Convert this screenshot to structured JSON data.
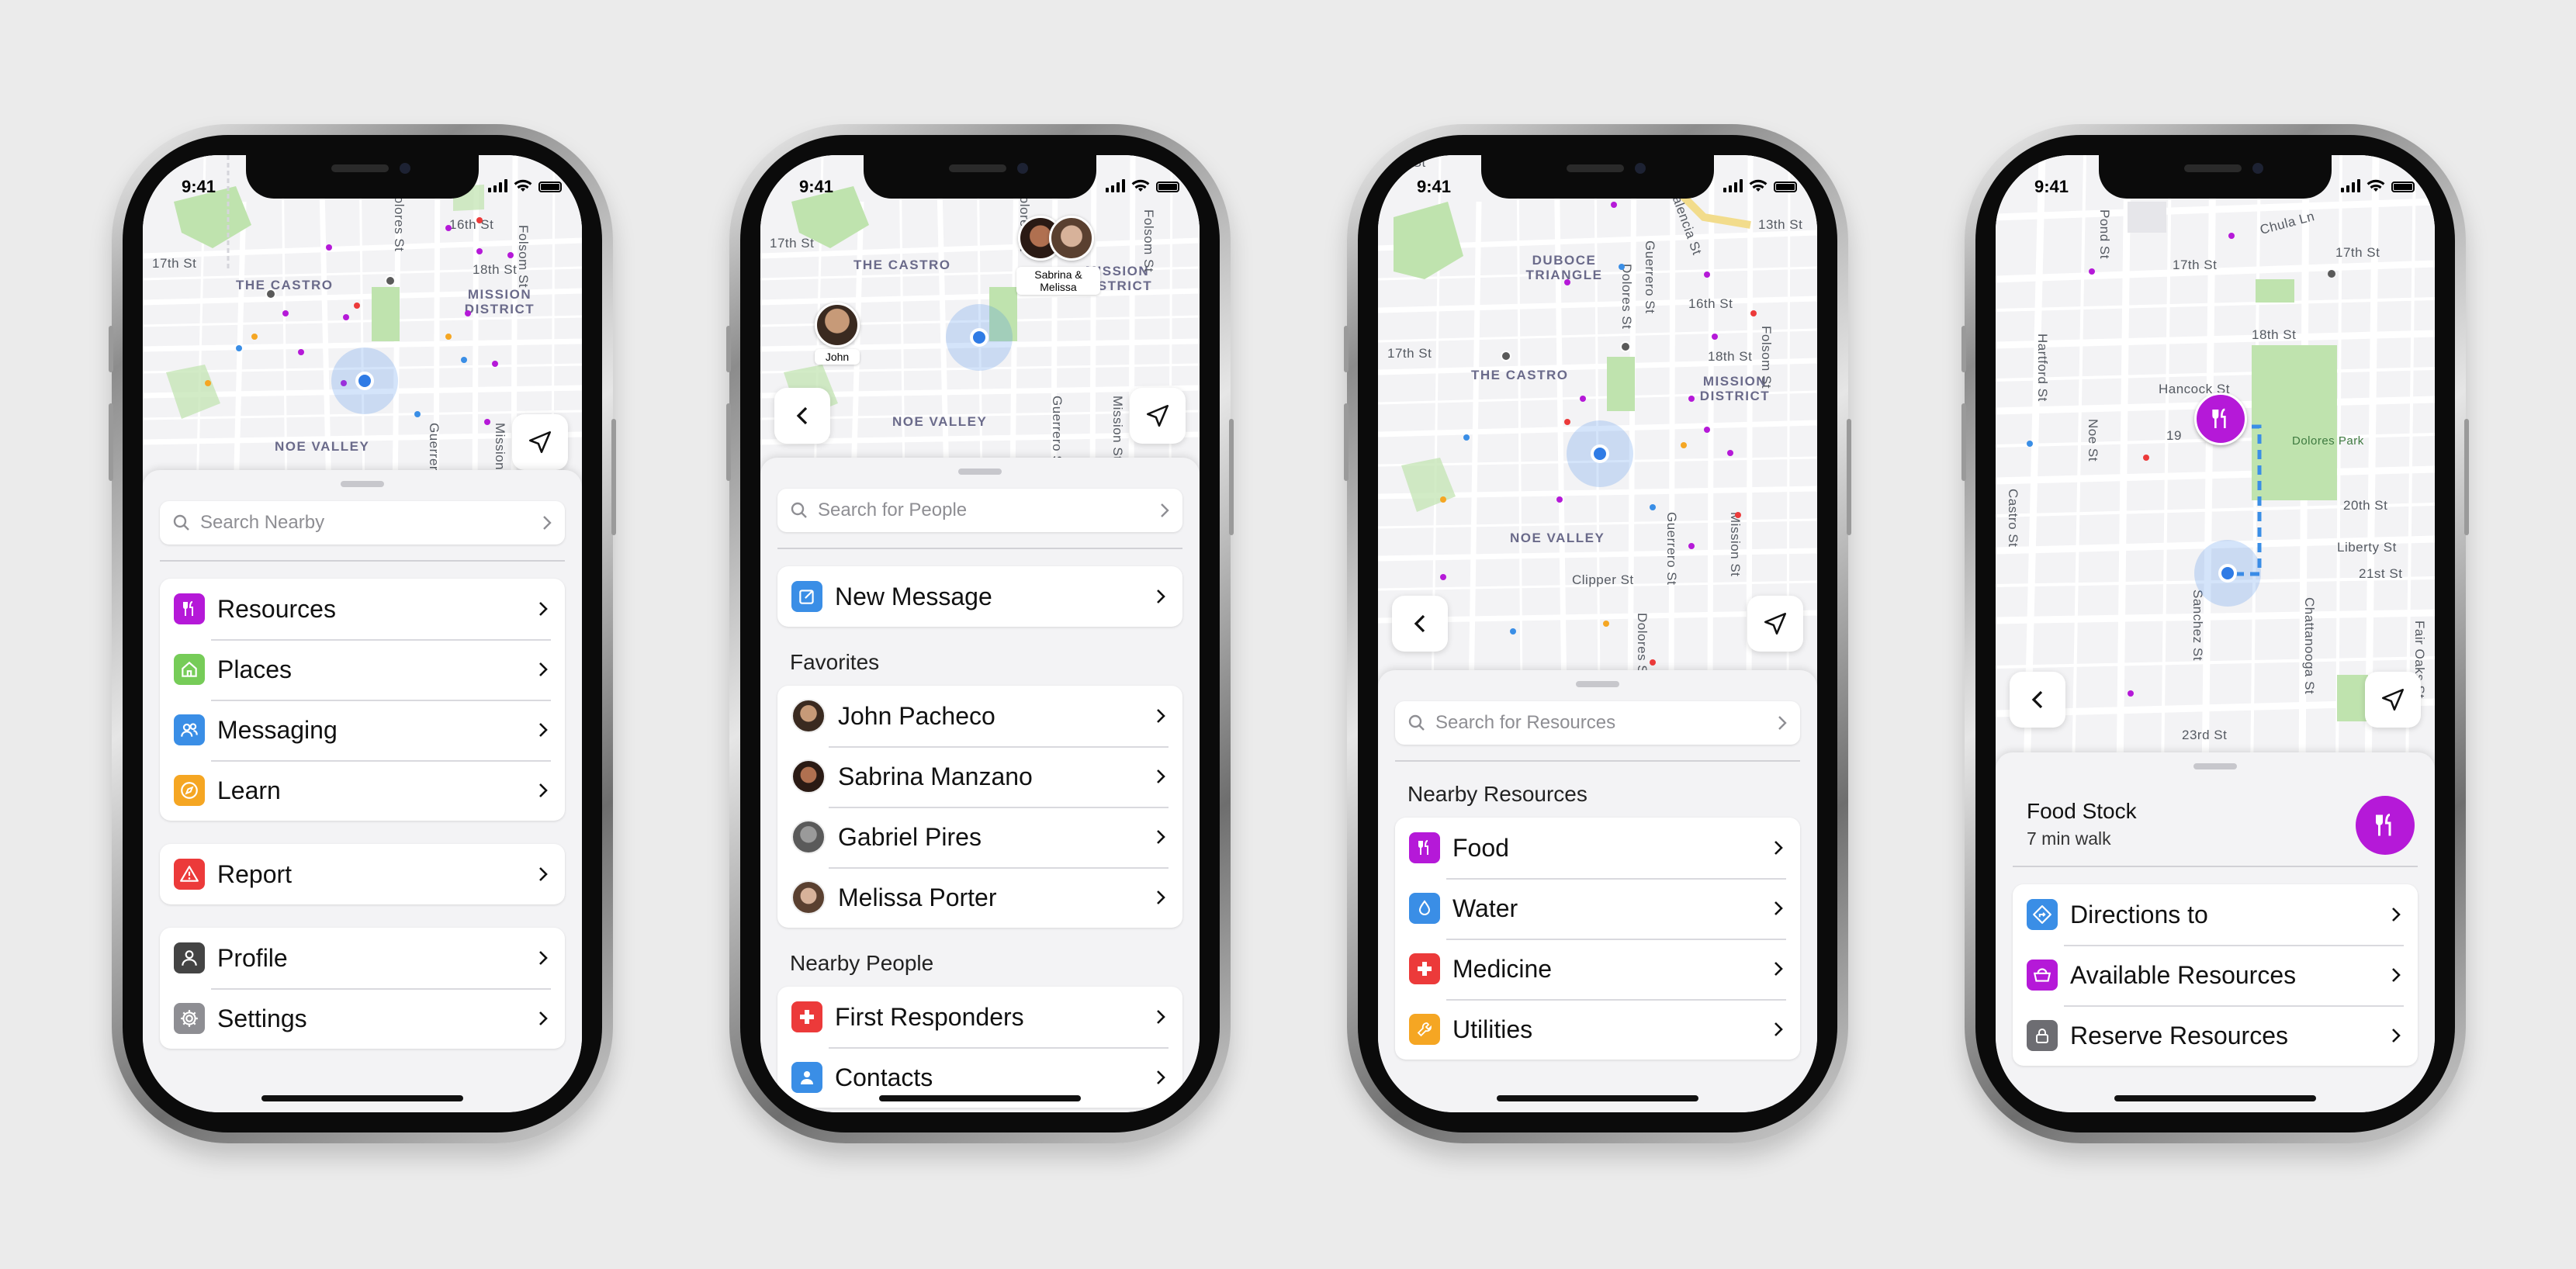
{
  "status_time": "9:41",
  "colors": {
    "purple": "#b519d8",
    "blue": "#3a8ee6",
    "orange": "#f5a623",
    "red": "#ec3a3a",
    "green": "#76cc58",
    "gray": "#555555"
  },
  "screen1": {
    "map_labels": [
      "17th St",
      "THE CASTRO",
      "16th St",
      "18th St",
      "MISSION DISTRICT",
      "Folsom St",
      "Dolores St",
      "Guerrero St",
      "Mission St",
      "NOE VALLEY"
    ],
    "search_placeholder": "Search Nearby",
    "group1": [
      {
        "label": "Resources",
        "icon": "fork-knife-icon",
        "color": "#b519d8"
      },
      {
        "label": "Places",
        "icon": "house-icon",
        "color": "#76cc58"
      },
      {
        "label": "Messaging",
        "icon": "people-icon",
        "color": "#3a8ee6"
      },
      {
        "label": "Learn",
        "icon": "compass-icon",
        "color": "#f5a623"
      }
    ],
    "group2": [
      {
        "label": "Report",
        "icon": "warning-icon",
        "color": "#ec3a3a"
      }
    ],
    "group3": [
      {
        "label": "Profile",
        "icon": "person-icon",
        "color": "#444444"
      },
      {
        "label": "Settings",
        "icon": "gear-icon",
        "color": "#8e8e93"
      }
    ]
  },
  "screen2": {
    "map_labels": [
      "17th St",
      "THE CASTRO",
      "MISSION DISTRICT",
      "Folsom St",
      "Dolores St",
      "NOE VALLEY",
      "Guerrero St",
      "Mission St"
    ],
    "pins": [
      {
        "label": "John"
      },
      {
        "label": "Sabrina & Melissa"
      }
    ],
    "search_placeholder": "Search for People",
    "new_message": {
      "label": "New Message",
      "icon": "compose-icon",
      "color": "#3a8ee6"
    },
    "favorites_title": "Favorites",
    "favorites": [
      {
        "name": "John Pacheco",
        "color": "#7a5a3c"
      },
      {
        "name": "Sabrina Manzano",
        "color": "#b05a3a"
      },
      {
        "name": "Gabriel Pires",
        "color": "#8a8a8a"
      },
      {
        "name": "Melissa Porter",
        "color": "#6a5040"
      }
    ],
    "nearby_title": "Nearby People",
    "nearby": [
      {
        "label": "First Responders",
        "icon": "cross-icon",
        "color": "#ec3a3a"
      },
      {
        "label": "Contacts",
        "icon": "person-icon",
        "color": "#3a8ee6"
      }
    ]
  },
  "screen3": {
    "map_labels": [
      "Fell St",
      "Valencia St",
      "13th St",
      "DUBOCE TRIANGLE",
      "Guerrero St",
      "Dolores St",
      "16th St",
      "18th St",
      "17th St",
      "THE CASTRO",
      "MISSION DISTRICT",
      "Folsom St",
      "NOE VALLEY",
      "Guerrero St",
      "Mission St",
      "Clipper St",
      "Dolores St"
    ],
    "search_placeholder": "Search for Resources",
    "section_title": "Nearby Resources",
    "items": [
      {
        "label": "Food",
        "icon": "fork-knife-icon",
        "color": "#b519d8"
      },
      {
        "label": "Water",
        "icon": "drop-icon",
        "color": "#3a8ee6"
      },
      {
        "label": "Medicine",
        "icon": "cross-icon",
        "color": "#ec3a3a"
      },
      {
        "label": "Utilities",
        "icon": "wrench-icon",
        "color": "#f5a623"
      }
    ]
  },
  "screen4": {
    "map_labels": [
      "Pond St",
      "Chula Ln",
      "17th St",
      "17th St",
      "18th St",
      "Hancock St",
      "19",
      "Dolores Park",
      "Hartford St",
      "Noe St",
      "20th St",
      "Castro St",
      "Liberty St",
      "21st St",
      "Sanchez St",
      "Chattanooga St",
      "Fair Oaks St",
      "23rd St"
    ],
    "place_name": "Food Stock",
    "place_subtitle": "7 min walk",
    "items": [
      {
        "label": "Directions to",
        "icon": "directions-icon",
        "color": "#3a8ee6"
      },
      {
        "label": "Available Resources",
        "icon": "basket-icon",
        "color": "#b519d8"
      },
      {
        "label": "Reserve Resources",
        "icon": "lock-icon",
        "color": "#6d6d72"
      }
    ]
  }
}
